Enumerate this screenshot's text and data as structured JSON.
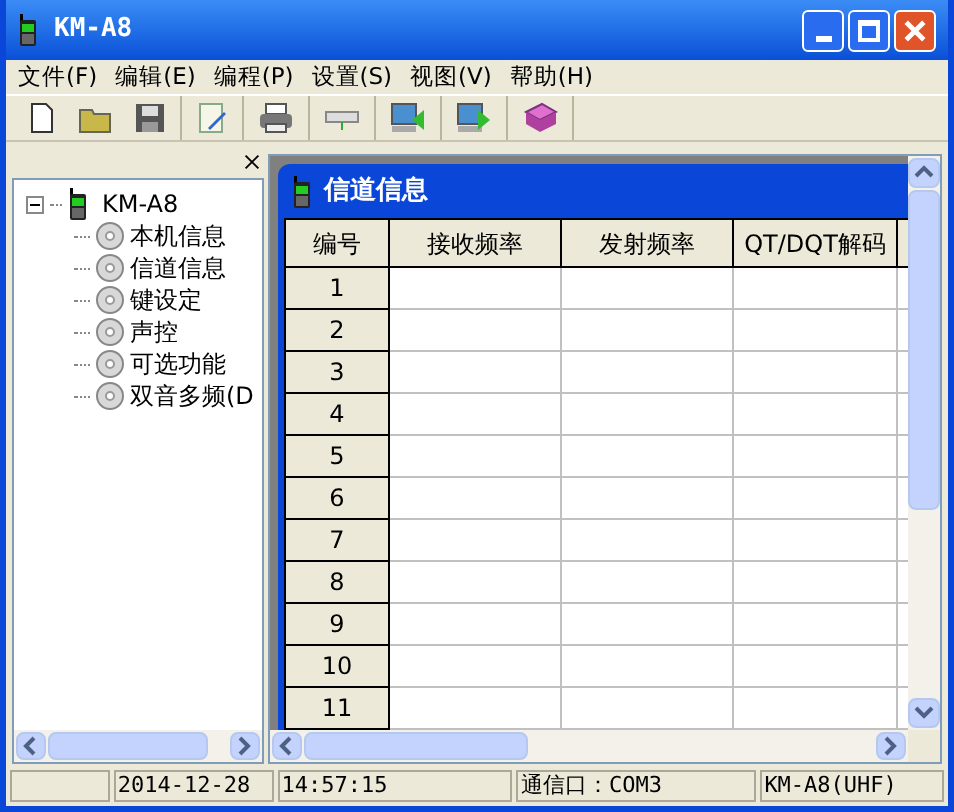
{
  "window": {
    "title": "KM-A8"
  },
  "menu": [
    "文件(F)",
    "编辑(E)",
    "编程(P)",
    "设置(S)",
    "视图(V)",
    "帮助(H)"
  ],
  "tree": {
    "label": "KM-A8",
    "expanded": true,
    "children": [
      {
        "label": "本机信息"
      },
      {
        "label": "信道信息"
      },
      {
        "label": "键设定"
      },
      {
        "label": "声控"
      },
      {
        "label": "可选功能"
      },
      {
        "label": "双音多频(D"
      }
    ]
  },
  "child_window": {
    "title": "信道信息"
  },
  "table": {
    "columns": [
      "编号",
      "接收频率",
      "发射频率",
      "QT/DQT解码"
    ],
    "rows": [
      "1",
      "2",
      "3",
      "4",
      "5",
      "6",
      "7",
      "8",
      "9",
      "10",
      "11"
    ]
  },
  "status_bar": [
    "2014-12-28",
    "14:57:15",
    "通信口：COM3",
    "KM-A8(UHF)"
  ]
}
